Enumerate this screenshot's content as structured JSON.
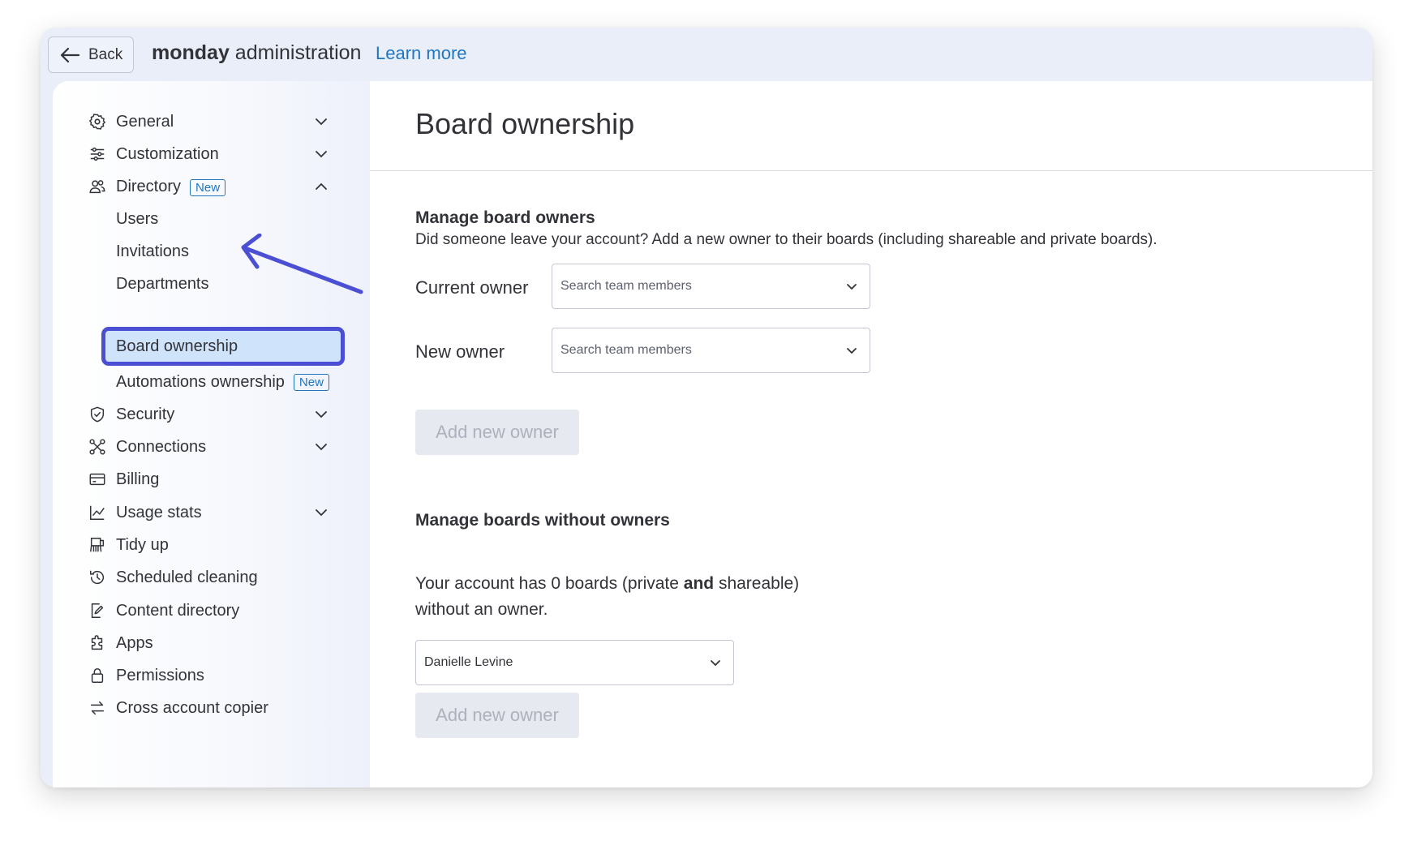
{
  "header": {
    "back_label": "Back",
    "brand_bold": "monday",
    "brand_rest": " administration",
    "learn_more": "Learn more"
  },
  "sidebar": {
    "items": [
      {
        "label": "General",
        "icon": "gear-icon",
        "expandable": true,
        "expanded": false
      },
      {
        "label": "Customization",
        "icon": "sliders-icon",
        "expandable": true,
        "expanded": false
      },
      {
        "label": "Directory",
        "icon": "users-icon",
        "expandable": true,
        "expanded": true,
        "badge": "New"
      },
      {
        "label": "Security",
        "icon": "shield-icon",
        "expandable": true,
        "expanded": false
      },
      {
        "label": "Connections",
        "icon": "connections-icon",
        "expandable": true,
        "expanded": false
      },
      {
        "label": "Billing",
        "icon": "credit-card-icon",
        "expandable": false
      },
      {
        "label": "Usage stats",
        "icon": "chart-icon",
        "expandable": true,
        "expanded": false
      },
      {
        "label": "Tidy up",
        "icon": "broom-icon",
        "expandable": false
      },
      {
        "label": "Scheduled cleaning",
        "icon": "history-icon",
        "expandable": false
      },
      {
        "label": "Content directory",
        "icon": "edit-doc-icon",
        "expandable": false
      },
      {
        "label": "Apps",
        "icon": "puzzle-icon",
        "expandable": false
      },
      {
        "label": "Permissions",
        "icon": "lock-icon",
        "expandable": false
      },
      {
        "label": "Cross account copier",
        "icon": "swap-icon",
        "expandable": false
      }
    ],
    "directory_sub": [
      {
        "label": "Users"
      },
      {
        "label": "Invitations"
      },
      {
        "label": "Departments"
      },
      {
        "label": "Board ownership",
        "selected": true
      },
      {
        "label": "Automations ownership",
        "badge": "New"
      }
    ]
  },
  "main": {
    "title": "Board ownership",
    "manage_owners": {
      "title": "Manage board owners",
      "description": "Did someone leave your account? Add a new owner to their boards (including shareable and private boards).",
      "current_owner_label": "Current owner",
      "current_owner_placeholder": "Search team members",
      "new_owner_label": "New owner",
      "new_owner_placeholder": "Search team members",
      "add_button": "Add new owner"
    },
    "without_owners": {
      "title": "Manage boards without owners",
      "text_part1": "Your account has 0 boards (private ",
      "text_bold": "and",
      "text_part2": " shareable)",
      "text_line2": "without an owner.",
      "selected_user": "Danielle Levine",
      "add_button": "Add new owner"
    }
  },
  "colors": {
    "accent": "#4a4fd3",
    "link": "#1f76c2",
    "selected_bg": "#cfe3fb"
  }
}
